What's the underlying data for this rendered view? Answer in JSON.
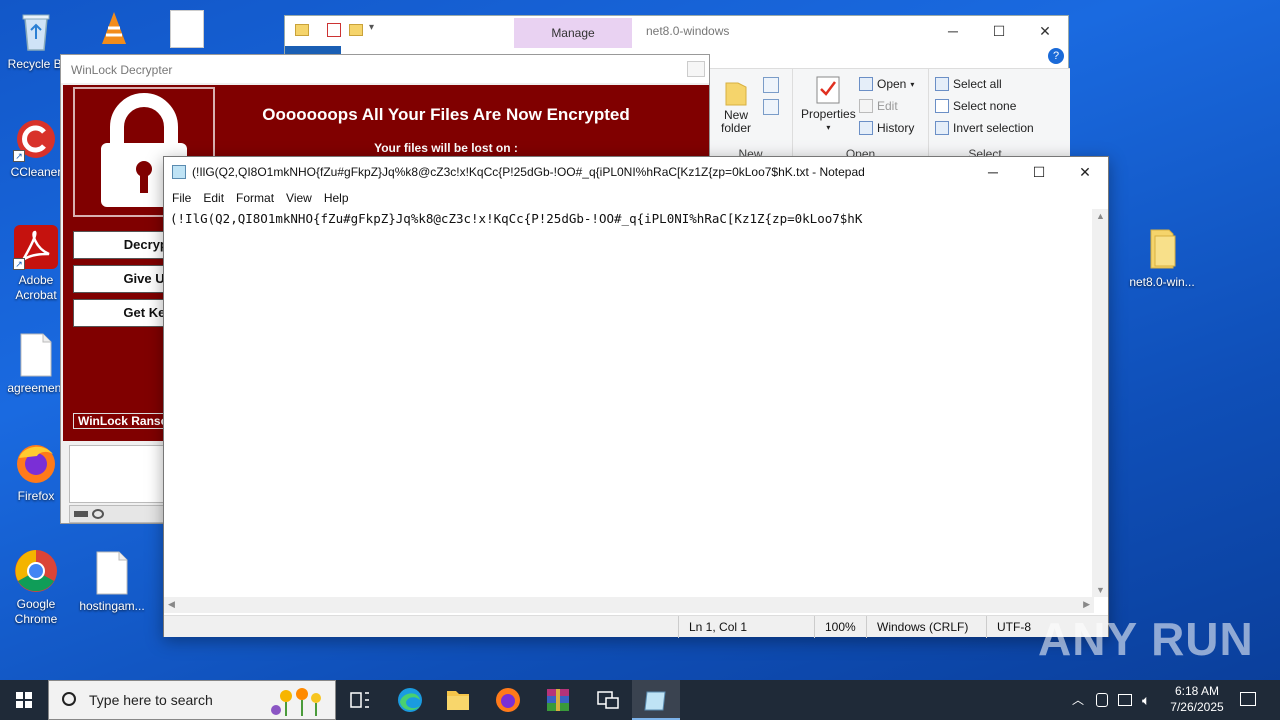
{
  "desktop": {
    "icons": [
      {
        "label": "Recycle Bi",
        "icon": "recycle-bin-icon"
      },
      {
        "label": "CCleaner",
        "icon": "ccleaner-icon"
      },
      {
        "label": "Adobe Acrobat",
        "icon": "adobe-acrobat-icon"
      },
      {
        "label": "agreement",
        "icon": "document-icon"
      },
      {
        "label": "Firefox",
        "icon": "firefox-icon"
      },
      {
        "label": "Google Chrome",
        "icon": "chrome-icon"
      },
      {
        "label": "hostingam...",
        "icon": "document-icon"
      },
      {
        "label": "net8.0-win...",
        "icon": "folder-icon"
      }
    ]
  },
  "explorer": {
    "manage_tab": "Manage",
    "title": "net8.0-windows",
    "ribbon": {
      "new_folder": "New folder",
      "new_group": "New",
      "properties": "Properties",
      "open": "Open",
      "edit": "Edit",
      "history": "History",
      "open_group": "Open",
      "select_all": "Select all",
      "select_none": "Select none",
      "invert_selection": "Invert selection",
      "select_group": "Select"
    }
  },
  "winlock": {
    "title": "WinLock Decrypter",
    "heading": "Ooooooops All Your Files Are Now Encrypted",
    "subheading": "Your files will be lost on :",
    "buttons": {
      "decrypt": "Decrypt",
      "give_up": "Give Up",
      "get_key": "Get Key"
    },
    "footer": "WinLock Ransomware"
  },
  "notepad": {
    "title": "(!IlG(Q2,QI8O1mkNHO{fZu#gFkpZ}Jq%k8@cZ3c!x!KqCc{P!25dGb-!OO#_q{iPL0NI%hRaC[Kz1Z{zp=0kLoo7$hK.txt - Notepad",
    "menu": {
      "file": "File",
      "edit": "Edit",
      "format": "Format",
      "view": "View",
      "help": "Help"
    },
    "content": "(!IlG(Q2,QI8O1mkNHO{fZu#gFkpZ}Jq%k8@cZ3c!x!KqCc{P!25dGb-!OO#_q{iPL0NI%hRaC[Kz1Z{zp=0kLoo7$hK",
    "status": {
      "position": "Ln 1, Col 1",
      "zoom": "100%",
      "line_endings": "Windows (CRLF)",
      "encoding": "UTF-8"
    }
  },
  "taskbar": {
    "search_placeholder": "Type here to search",
    "time": "6:18 AM",
    "date": "7/26/2025"
  },
  "watermark": "ANY RUN"
}
